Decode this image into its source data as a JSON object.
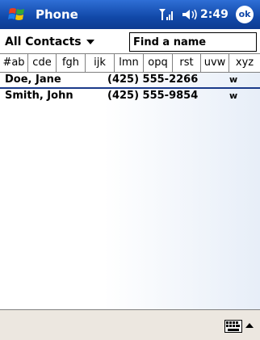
{
  "titlebar": {
    "title": "Phone",
    "time": "2:49",
    "ok_label": "ok",
    "icons": [
      "windows-start-icon",
      "signal-strength-icon",
      "speaker-icon"
    ]
  },
  "toolbar": {
    "filter_label": "All Contacts",
    "search_placeholder": "Find a name"
  },
  "tabs": [
    "#ab",
    "cde",
    "fgh",
    "ijk",
    "lmn",
    "opq",
    "rst",
    "uvw",
    "xyz"
  ],
  "contacts": [
    {
      "name": "Doe, Jane",
      "phone": "(425) 555-2266",
      "type": "w"
    },
    {
      "name": "Smith, John",
      "phone": "(425) 555-9854",
      "type": "w"
    }
  ],
  "cmdbar": {
    "icons": [
      "keyboard-icon",
      "input-menu-arrow-icon"
    ]
  },
  "colors": {
    "title_blue": "#1148a8",
    "selection_line": "#1a3a8a",
    "cmdbar_bg": "#ece7e0"
  }
}
